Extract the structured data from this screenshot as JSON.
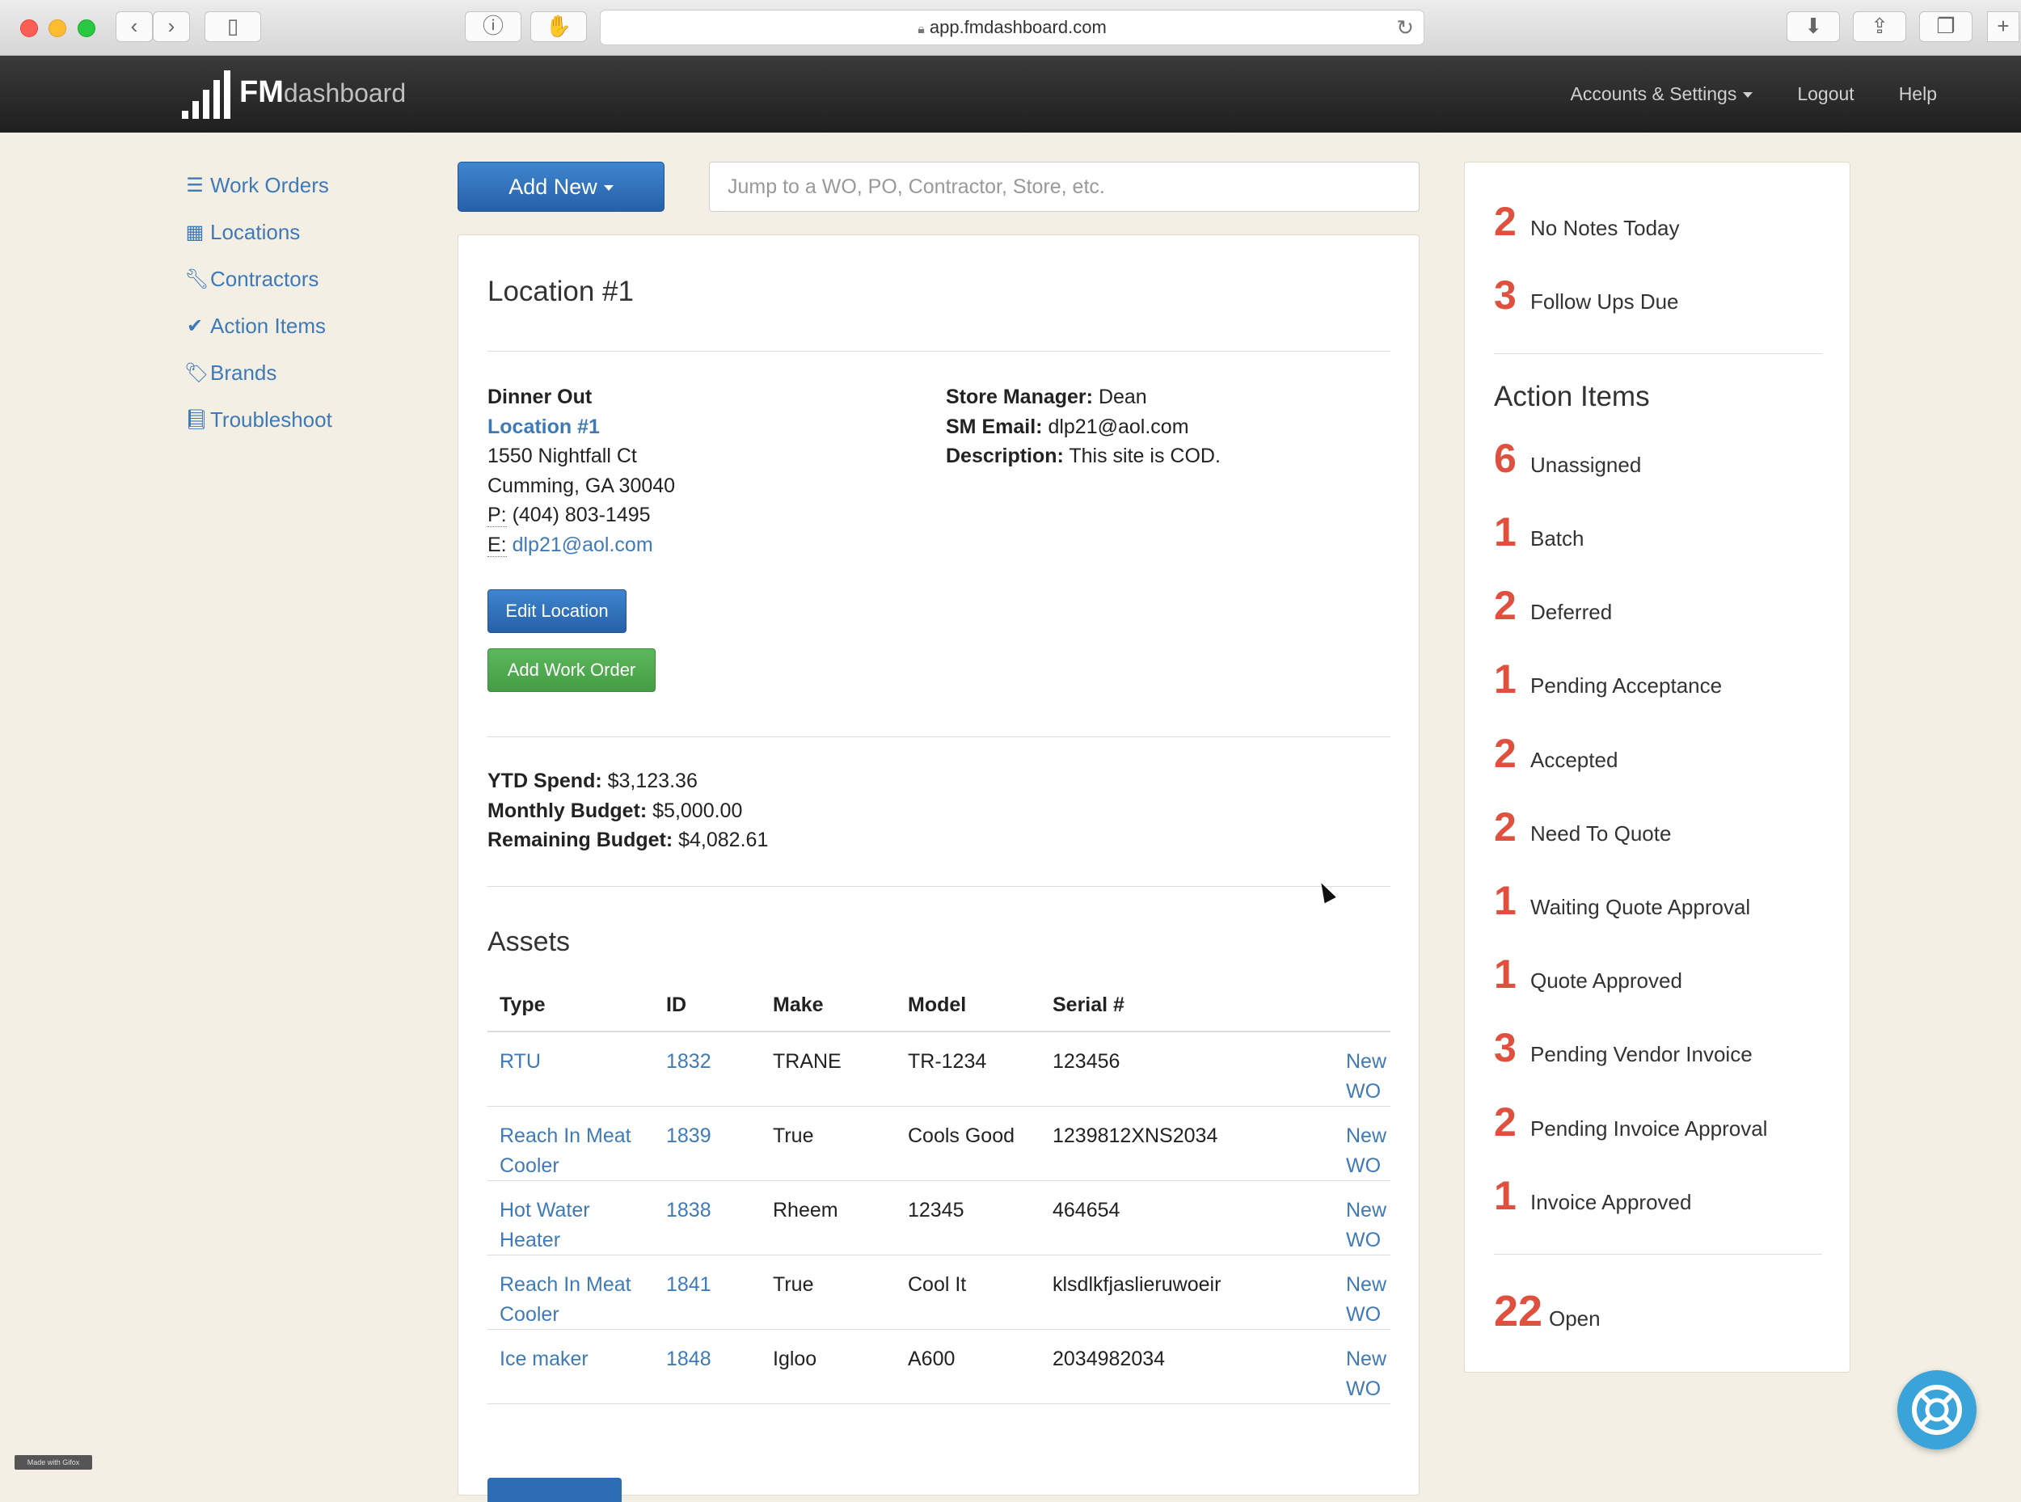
{
  "browser": {
    "url": "app.fmdashboard.com"
  },
  "nav": {
    "logo_bold": "FM",
    "logo_light": "dashboard",
    "accounts": "Accounts & Settings",
    "logout": "Logout",
    "help": "Help"
  },
  "sidebar": [
    {
      "label": "Work Orders",
      "icon": "list-icon"
    },
    {
      "label": "Locations",
      "icon": "building-icon"
    },
    {
      "label": "Contractors",
      "icon": "wrench-icon"
    },
    {
      "label": "Action Items",
      "icon": "check-icon"
    },
    {
      "label": "Brands",
      "icon": "tags-icon"
    },
    {
      "label": "Troubleshoot",
      "icon": "book-icon"
    }
  ],
  "controls": {
    "add_new": "Add New",
    "search_placeholder": "Jump to a WO, PO, Contractor, Store, etc."
  },
  "location": {
    "title": "Location #1",
    "company": "Dinner Out",
    "name": "Location #1",
    "street": "1550 Nightfall Ct",
    "city": "Cumming, GA 30040",
    "phone_label": "P:",
    "phone": "(404) 803-1495",
    "email_label": "E:",
    "email": "dlp21@aol.com",
    "store_manager_label": "Store Manager:",
    "store_manager": "Dean",
    "sm_email_label": "SM Email:",
    "sm_email": "dlp21@aol.com",
    "description_label": "Description:",
    "description": "This site is COD.",
    "edit_button": "Edit Location",
    "add_wo_button": "Add Work Order",
    "ytd_label": "YTD Spend:",
    "ytd": "$3,123.36",
    "monthly_label": "Monthly Budget:",
    "monthly": "$5,000.00",
    "remaining_label": "Remaining Budget:",
    "remaining": "$4,082.61"
  },
  "assets": {
    "title": "Assets",
    "headers": [
      "Type",
      "ID",
      "Make",
      "Model",
      "Serial #"
    ],
    "rows": [
      {
        "type": "RTU",
        "id": "1832",
        "make": "TRANE",
        "model": "TR-1234",
        "serial": "123456",
        "action": "New WO"
      },
      {
        "type": "Reach In Meat Cooler",
        "id": "1839",
        "make": "True",
        "model": "Cools Good",
        "serial": "1239812XNS2034",
        "action": "New WO"
      },
      {
        "type": "Hot Water Heater",
        "id": "1838",
        "make": "Rheem",
        "model": "12345",
        "serial": "464654",
        "action": "New WO"
      },
      {
        "type": "Reach In Meat Cooler",
        "id": "1841",
        "make": "True",
        "model": "Cool It",
        "serial": "klsdlkfjaslieruwoeir",
        "action": "New WO"
      },
      {
        "type": "Ice maker",
        "id": "1848",
        "make": "Igloo",
        "model": "A600",
        "serial": "2034982034",
        "action": "New WO"
      }
    ]
  },
  "summary": {
    "top": [
      {
        "n": "2",
        "label": "No Notes Today"
      },
      {
        "n": "3",
        "label": "Follow Ups Due"
      }
    ],
    "action_title": "Action Items",
    "items": [
      {
        "n": "6",
        "label": "Unassigned"
      },
      {
        "n": "1",
        "label": "Batch"
      },
      {
        "n": "2",
        "label": "Deferred"
      },
      {
        "n": "1",
        "label": "Pending Acceptance"
      },
      {
        "n": "2",
        "label": "Accepted"
      },
      {
        "n": "2",
        "label": "Need To Quote"
      },
      {
        "n": "1",
        "label": "Waiting Quote Approval"
      },
      {
        "n": "1",
        "label": "Quote Approved"
      },
      {
        "n": "3",
        "label": "Pending Vendor Invoice"
      },
      {
        "n": "2",
        "label": "Pending Invoice Approval"
      },
      {
        "n": "1",
        "label": "Invoice Approved"
      }
    ],
    "open_n": "22",
    "open_label": "Open"
  },
  "footer": {
    "made_with": "Made with Gifox"
  },
  "colors": {
    "accent": "#3f7ab8",
    "count": "#e0503e",
    "primary_button": "#2c6db4",
    "success_button": "#4cae4c",
    "help_button": "#3aa3d9"
  }
}
